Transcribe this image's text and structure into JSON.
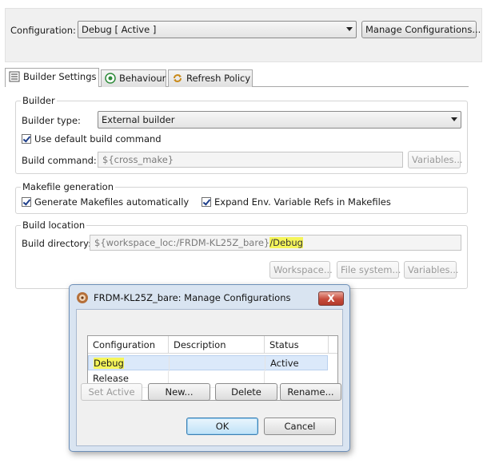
{
  "config_bar": {
    "label": "Configuration:",
    "selected": "Debug  [ Active ]",
    "manage_button": "Manage Configurations..."
  },
  "tabs": [
    {
      "label": "Builder Settings",
      "icon": "list-icon",
      "active": true
    },
    {
      "label": "Behaviour",
      "icon": "radio-icon",
      "active": false
    },
    {
      "label": "Refresh Policy",
      "icon": "refresh-icon",
      "active": false
    }
  ],
  "builder": {
    "group_title": "Builder",
    "type_label": "Builder type:",
    "type_value": "External builder",
    "use_default_label": "Use default build command",
    "use_default_checked": true,
    "command_label": "Build command:",
    "command_value": "${cross_make}",
    "variables_button": "Variables..."
  },
  "makefile": {
    "group_title": "Makefile generation",
    "generate_label": "Generate Makefiles automatically",
    "generate_checked": true,
    "expand_label": "Expand Env. Variable Refs in Makefiles",
    "expand_checked": true
  },
  "location": {
    "group_title": "Build location",
    "dir_label": "Build directory:",
    "dir_value_prefix": "${workspace_loc:/FRDM-KL25Z_bare}",
    "dir_value_suffix": "/Debug",
    "workspace_button": "Workspace...",
    "filesystem_button": "File system...",
    "variables_button": "Variables..."
  },
  "dialog": {
    "title": "FRDM-KL25Z_bare: Manage Configurations",
    "close_label": "X",
    "columns": [
      "Configuration",
      "Description",
      "Status"
    ],
    "rows": [
      {
        "name": "Debug",
        "description": "",
        "status": "Active",
        "selected": true
      },
      {
        "name": "Release",
        "description": "",
        "status": "",
        "selected": false
      }
    ],
    "buttons": {
      "set_active": "Set Active",
      "new": "New...",
      "delete": "Delete",
      "rename": "Rename...",
      "ok": "OK",
      "cancel": "Cancel"
    }
  },
  "colors": {
    "highlight": "#f5f55a",
    "close_button": "#c74c3c",
    "dialog_frame": "#d9e4f1"
  }
}
